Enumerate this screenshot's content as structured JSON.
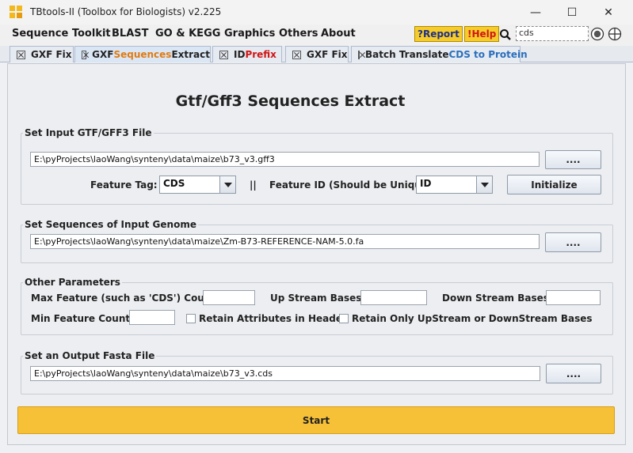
{
  "window": {
    "title": "TBtools-II (Toolbox for Biologists) v2.225",
    "minimize": "—",
    "maximize": "☐",
    "close": "✕"
  },
  "menu": {
    "items": [
      "Sequence Toolkit",
      "BLAST",
      "GO & KEGG",
      "Graphics",
      "Others",
      "About"
    ],
    "report": "?Report",
    "help": "!Help",
    "search_value": "cds"
  },
  "tabs": [
    {
      "pre": "GXF Fix",
      "hl": "",
      "post": ""
    },
    {
      "pre": "GXF ",
      "hl": "Sequences",
      "post": " Extract"
    },
    {
      "pre": "ID ",
      "hl": "Prefix",
      "post": ""
    },
    {
      "pre": "GXF Fix",
      "hl": "",
      "post": ""
    },
    {
      "pre": "Batch Translate ",
      "hl": "CDS to Protein",
      "post": ""
    }
  ],
  "main": {
    "title": "Gtf/Gff3 Sequences Extract",
    "gff": {
      "group_title": "Set Input GTF/GFF3 File",
      "path": "E:\\pyProjects\\laoWang\\synteny\\data\\maize\\b73_v3.gff3",
      "browse": "....",
      "feature_tag_label": "Feature Tag:",
      "feature_tag_value": "CDS",
      "separator": "||",
      "feature_id_label": "Feature ID (Should be Unique!):",
      "feature_id_value": "ID",
      "initialize": "Initialize"
    },
    "genome": {
      "group_title": "Set Sequences of Input Genome",
      "path": "E:\\pyProjects\\laoWang\\synteny\\data\\maize\\Zm-B73-REFERENCE-NAM-5.0.fa",
      "browse": "...."
    },
    "params": {
      "group_title": "Other Parameters",
      "max_feature_label": "Max Feature (such as 'CDS') Counts:",
      "max_feature_value": "",
      "upstream_label": "Up Stream Bases:",
      "upstream_value": "",
      "downstream_label": "Down Stream Bases:",
      "downstream_value": "",
      "min_feature_label": "Min Feature Counts:",
      "min_feature_value": "",
      "retain_attr_label": "Retain Attributes in Header",
      "retain_updown_label": "Retain Only UpStream or DownStream Bases"
    },
    "output": {
      "group_title": "Set an Output Fasta File",
      "path": "E:\\pyProjects\\laoWang\\synteny\\data\\maize\\b73_v3.cds",
      "browse": "...."
    },
    "start": "Start"
  }
}
